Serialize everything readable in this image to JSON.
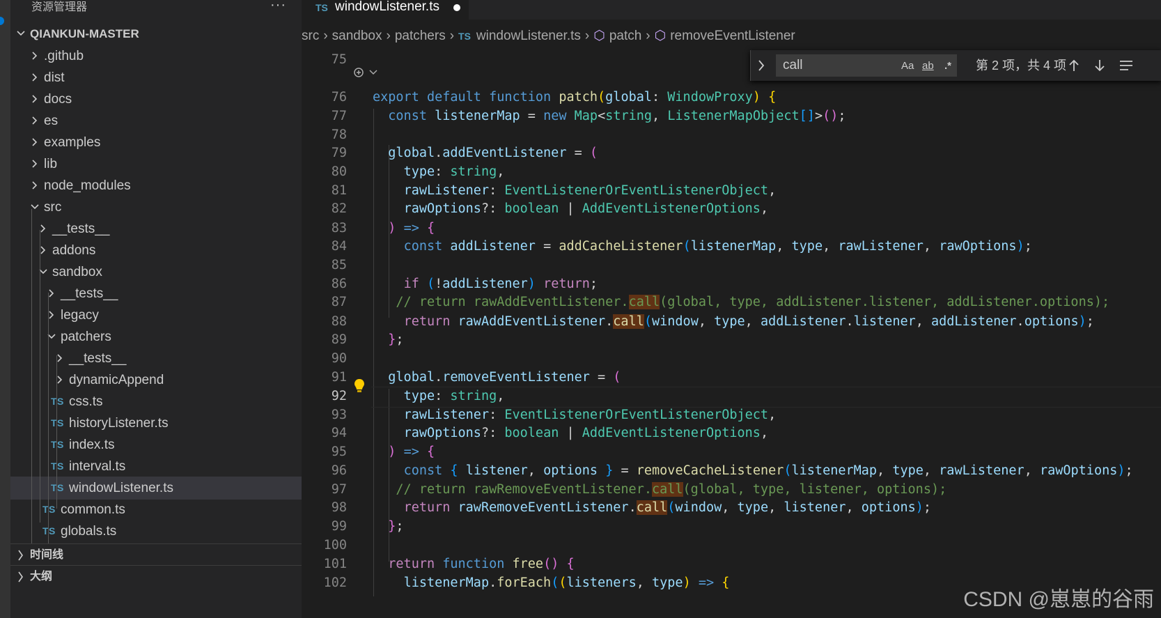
{
  "sidebar": {
    "title": "资源管理器",
    "more": "···",
    "root": "QIANKUN-MASTER",
    "tree": [
      {
        "label": ".github",
        "kind": "folder",
        "open": false,
        "depth": 1
      },
      {
        "label": "dist",
        "kind": "folder",
        "open": false,
        "depth": 1
      },
      {
        "label": "docs",
        "kind": "folder",
        "open": false,
        "depth": 1
      },
      {
        "label": "es",
        "kind": "folder",
        "open": false,
        "depth": 1
      },
      {
        "label": "examples",
        "kind": "folder",
        "open": false,
        "depth": 1
      },
      {
        "label": "lib",
        "kind": "folder",
        "open": false,
        "depth": 1
      },
      {
        "label": "node_modules",
        "kind": "folder",
        "open": false,
        "depth": 1
      },
      {
        "label": "src",
        "kind": "folder",
        "open": true,
        "depth": 1
      },
      {
        "label": "__tests__",
        "kind": "folder",
        "open": false,
        "depth": 2
      },
      {
        "label": "addons",
        "kind": "folder",
        "open": false,
        "depth": 2
      },
      {
        "label": "sandbox",
        "kind": "folder",
        "open": true,
        "depth": 2
      },
      {
        "label": "__tests__",
        "kind": "folder",
        "open": false,
        "depth": 3
      },
      {
        "label": "legacy",
        "kind": "folder",
        "open": false,
        "depth": 3
      },
      {
        "label": "patchers",
        "kind": "folder",
        "open": true,
        "depth": 3
      },
      {
        "label": "__tests__",
        "kind": "folder",
        "open": false,
        "depth": 4
      },
      {
        "label": "dynamicAppend",
        "kind": "folder",
        "open": false,
        "depth": 4
      },
      {
        "label": "css.ts",
        "kind": "file",
        "depth": 4
      },
      {
        "label": "historyListener.ts",
        "kind": "file",
        "depth": 4
      },
      {
        "label": "index.ts",
        "kind": "file",
        "depth": 4
      },
      {
        "label": "interval.ts",
        "kind": "file",
        "depth": 4
      },
      {
        "label": "windowListener.ts",
        "kind": "file",
        "depth": 4,
        "selected": true
      },
      {
        "label": "common.ts",
        "kind": "file",
        "depth": 3
      },
      {
        "label": "globals.ts",
        "kind": "file",
        "depth": 3
      }
    ],
    "ts_badge": "TS",
    "timeline": "时间线",
    "outline": "大纲"
  },
  "tab": {
    "ts_badge": "TS",
    "name": "windowListener.ts"
  },
  "breadcrumb": [
    "src",
    "sandbox",
    "patchers",
    "windowListener.ts",
    "patch",
    "removeEventListener"
  ],
  "find": {
    "query": "call",
    "match_case": "Aa",
    "whole_word": "ab",
    "regex": ".*",
    "count": "第 2 项，共 4 项"
  },
  "editor": {
    "current_line": 92,
    "lines": [
      {
        "n": "75",
        "html": ""
      },
      {
        "n": "",
        "html": ""
      },
      {
        "n": "76",
        "html": "<span class='k'>export</span> <span class='k'>default</span> <span class='k'>function</span> <span class='f'>patch</span><span class='b1'>(</span><span class='v'>global</span>: <span class='t'>WindowProxy</span><span class='b1'>)</span> <span class='b1'>{</span>"
      },
      {
        "n": "77",
        "html": "  <span class='k'>const</span> <span class='v'>listenerMap</span> = <span class='k'>new</span> <span class='t'>Map</span>&lt;<span class='t'>string</span>, <span class='t'>ListenerMapObject</span><span class='b3'>[]</span>&gt;<span class='b2'>()</span>;"
      },
      {
        "n": "78",
        "html": ""
      },
      {
        "n": "79",
        "html": "  <span class='v'>global</span>.<span class='v'>addEventListener</span> = <span class='b2'>(</span>"
      },
      {
        "n": "80",
        "html": "    <span class='v'>type</span>: <span class='t'>string</span>,"
      },
      {
        "n": "81",
        "html": "    <span class='v'>rawListener</span>: <span class='t'>EventListenerOrEventListenerObject</span>,"
      },
      {
        "n": "82",
        "html": "    <span class='v'>rawOptions</span>?: <span class='t'>boolean</span> | <span class='t'>AddEventListenerOptions</span>,"
      },
      {
        "n": "83",
        "html": "  <span class='b2'>)</span> <span class='k'>=&gt;</span> <span class='b2'>{</span>"
      },
      {
        "n": "84",
        "html": "    <span class='k'>const</span> <span class='v'>addListener</span> = <span class='f'>addCacheListener</span><span class='b3'>(</span><span class='v'>listenerMap</span>, <span class='v'>type</span>, <span class='v'>rawListener</span>, <span class='v'>rawOptions</span><span class='b3'>)</span>;"
      },
      {
        "n": "85",
        "html": ""
      },
      {
        "n": "86",
        "html": "    <span class='kc'>if</span> <span class='b3'>(</span>!<span class='v'>addListener</span><span class='b3'>)</span> <span class='kc'>return</span>;"
      },
      {
        "n": "87",
        "html": "   <span class='c'>// return rawAddEventListener.<span class='hl'>call</span>(global, type, addListener.listener, addListener.options);</span>"
      },
      {
        "n": "88",
        "html": "    <span class='kc'>return</span> <span class='v'>rawAddEventListener</span>.<span class='f hl'>call</span><span class='b3'>(</span><span class='v'>window</span>, <span class='v'>type</span>, <span class='v'>addListener</span>.<span class='v'>listener</span>, <span class='v'>addListener</span>.<span class='v'>options</span><span class='b3'>)</span>;"
      },
      {
        "n": "89",
        "html": "  <span class='b2'>}</span>;"
      },
      {
        "n": "90",
        "html": ""
      },
      {
        "n": "91",
        "html": "  <span class='v'>global</span>.<span class='v'>removeEventListener</span> = <span class='b2'>(</span>"
      },
      {
        "n": "92",
        "html": "    <span class='v'>type</span>: <span class='t'>string</span>,"
      },
      {
        "n": "93",
        "html": "    <span class='v'>rawListener</span>: <span class='t'>EventListenerOrEventListenerObject</span>,"
      },
      {
        "n": "94",
        "html": "    <span class='v'>rawOptions</span>?: <span class='t'>boolean</span> | <span class='t'>AddEventListenerOptions</span>,"
      },
      {
        "n": "95",
        "html": "  <span class='b2'>)</span> <span class='k'>=&gt;</span> <span class='b2'>{</span>"
      },
      {
        "n": "96",
        "html": "    <span class='k'>const</span> <span class='b3'>{</span> <span class='v'>listener</span>, <span class='v'>options</span> <span class='b3'>}</span> = <span class='f'>removeCacheListener</span><span class='b3'>(</span><span class='v'>listenerMap</span>, <span class='v'>type</span>, <span class='v'>rawListener</span>, <span class='v'>rawOptions</span><span class='b3'>)</span>;"
      },
      {
        "n": "97",
        "html": "   <span class='c'>// return rawRemoveEventListener.<span class='hl'>call</span>(global, type, listener, options);</span>"
      },
      {
        "n": "98",
        "html": "    <span class='kc'>return</span> <span class='v'>rawRemoveEventListener</span>.<span class='f hl'>call</span><span class='b3'>(</span><span class='v'>window</span>, <span class='v'>type</span>, <span class='v'>listener</span>, <span class='v'>options</span><span class='b3'>)</span>;"
      },
      {
        "n": "99",
        "html": "  <span class='b2'>}</span>;"
      },
      {
        "n": "100",
        "html": ""
      },
      {
        "n": "101",
        "html": "  <span class='kc'>return</span> <span class='k'>function</span> <span class='f'>free</span><span class='b2'>()</span> <span class='b2'>{</span>"
      },
      {
        "n": "102",
        "html": "    <span class='v'>listenerMap</span>.<span class='f'>forEach</span><span class='b3'>(</span><span class='b1'>(</span><span class='v'>listeners</span>, <span class='v'>type</span><span class='b1'>)</span> <span class='k'>=&gt;</span> <span class='b1'>{</span>"
      }
    ]
  },
  "watermark": "CSDN @崽崽的谷雨"
}
